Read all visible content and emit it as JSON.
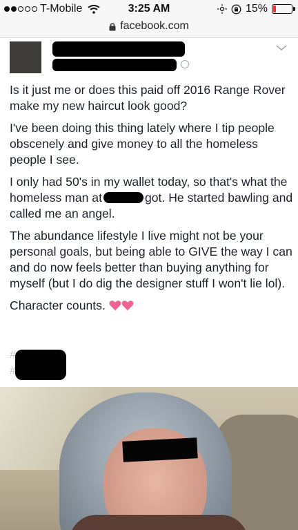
{
  "status_bar": {
    "carrier": "T-Mobile",
    "time": "3:25 AM",
    "battery": "15%",
    "battery_level": 0.15
  },
  "url_bar": {
    "domain": "facebook.com"
  },
  "post": {
    "paragraphs": [
      "Is it just me or does this paid off 2016 Range Rover make my new haircut look good?",
      "I've been doing this thing lately where I tip people obscenely and give money to all the homeless people I see.",
      "The abundance lifestyle I live might not be your personal goals, but being able to GIVE the way I can and do now feels better than buying anything for myself (but I do dig the designer stuff I won't lie lol)."
    ],
    "wallet_before": "I only had 50's in my wallet today, so that's what the homeless man at",
    "wallet_after": "got. He started bawling and called me an angel.",
    "closing": "Character counts.",
    "hashtag_prefix": "#"
  },
  "icons": {
    "lock": "lock-icon",
    "wifi": "wifi-icon",
    "heart": "heart-emoji-icon",
    "chevron": "chevron-down-icon",
    "globe": "globe-icon"
  },
  "colors": {
    "heart": "#f06292",
    "battery_low": "#e53935"
  }
}
